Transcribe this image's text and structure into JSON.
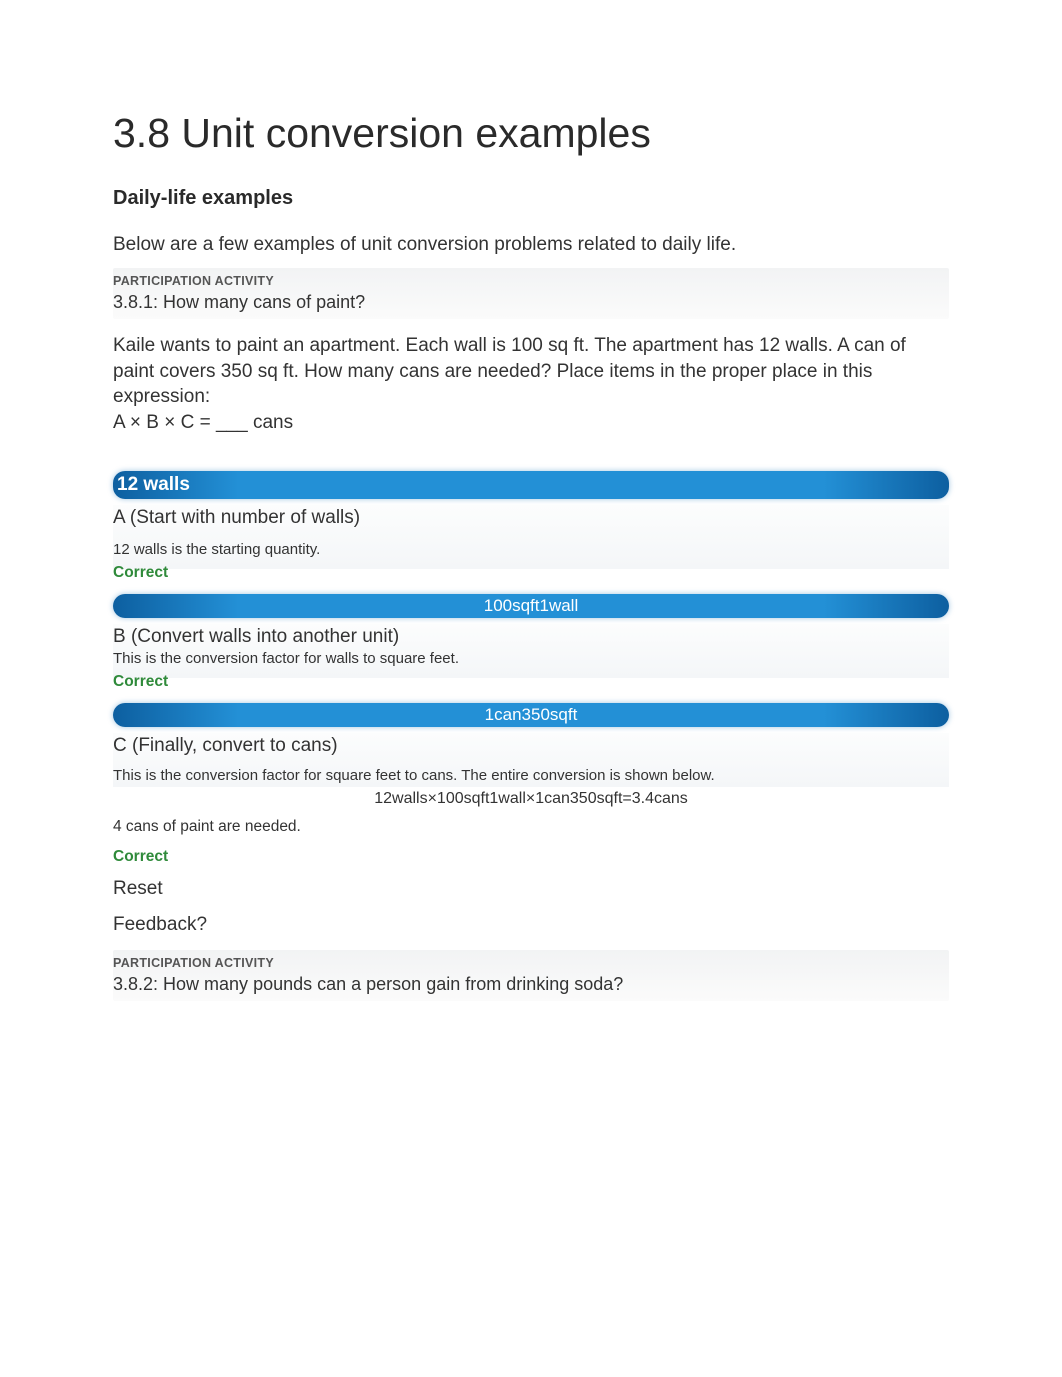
{
  "page": {
    "title": "3.8 Unit conversion examples"
  },
  "section": {
    "heading": "Daily-life examples",
    "intro": "Below are a few examples of unit conversion problems related to daily life."
  },
  "activity1": {
    "label": "PARTICIPATION ACTIVITY",
    "title": "3.8.1: How many cans of paint?",
    "problem": "Kaile wants to paint an apartment. Each wall is 100 sq ft. The apartment has 12 walls. A can of paint covers 350 sq ft. How many cans are needed? Place items in the proper place in this expression:",
    "expression": "A × B × C = ___ cans",
    "steps": {
      "a": {
        "chip": "12 walls",
        "desc": "A (Start with number of walls)",
        "explanation": "12 walls is the starting quantity.",
        "status": "Correct"
      },
      "b": {
        "chip": "100sqft1wall",
        "desc": "B (Convert walls into another unit)",
        "explanation": "This is the conversion factor for walls to square feet.",
        "status": "Correct"
      },
      "c": {
        "chip": "1can350sqft",
        "desc": "C (Finally, convert to cans)",
        "explanation": "This is the conversion factor for square feet to cans. The entire conversion is shown below.",
        "full_conversion": "12walls×100sqft1wall×1can350sqft=3.4cans",
        "result_note": "4 cans of paint are needed.",
        "status": "Correct"
      }
    },
    "reset": "Reset",
    "feedback": "Feedback?"
  },
  "activity2": {
    "label": "PARTICIPATION ACTIVITY",
    "title": "3.8.2: How many pounds can a person gain from drinking soda?"
  }
}
